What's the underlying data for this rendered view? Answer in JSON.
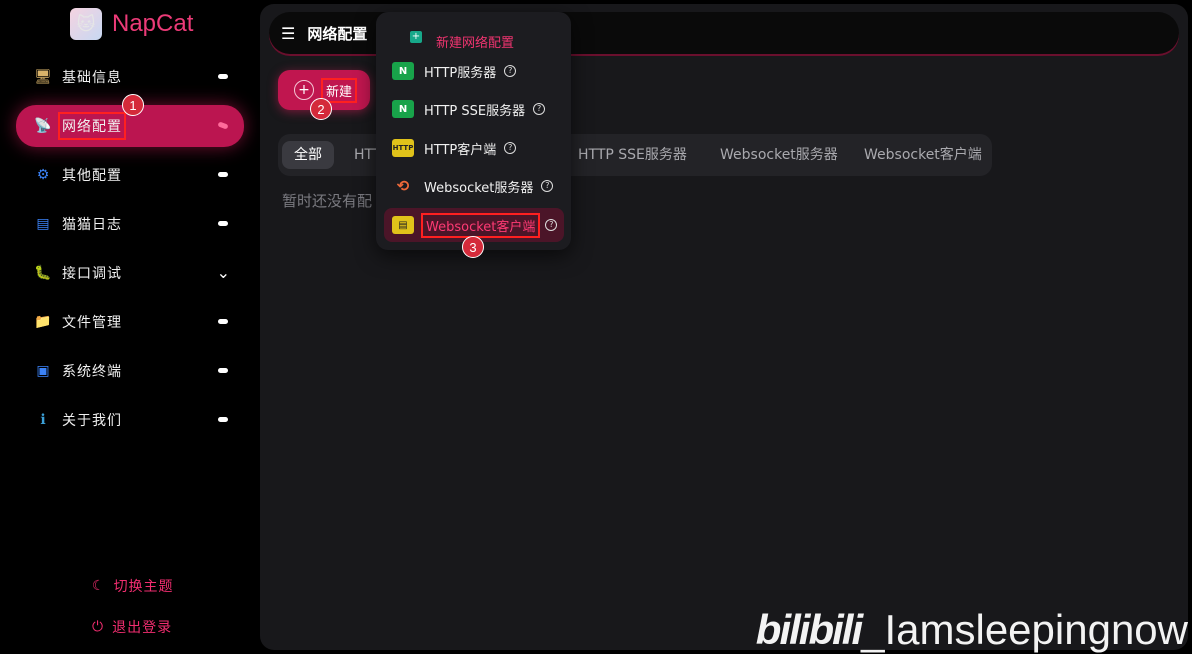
{
  "brand": {
    "name": "NapCat",
    "logo_icon": "cat-avatar-icon"
  },
  "sidebar": {
    "items": [
      {
        "label": "基础信息",
        "icon": "dashboard-icon"
      },
      {
        "label": "网络配置",
        "icon": "network-icon",
        "active": true
      },
      {
        "label": "其他配置",
        "icon": "gear-icon"
      },
      {
        "label": "猫猫日志",
        "icon": "log-icon"
      },
      {
        "label": "接口调试",
        "icon": "debug-icon"
      },
      {
        "label": "文件管理",
        "icon": "folder-icon"
      },
      {
        "label": "系统终端",
        "icon": "terminal-icon"
      },
      {
        "label": "关于我们",
        "icon": "info-icon"
      }
    ],
    "theme_toggle": "切换主题",
    "logout": "退出登录"
  },
  "header": {
    "title": "网络配置"
  },
  "toolbar": {
    "new_label": "新建"
  },
  "tabs": [
    "全部",
    "HTTP服务器",
    "HTTP SSE服务器",
    "HTTP客户端",
    "HTTP SSE服务器",
    "Websocket服务器",
    "Websocket客户端"
  ],
  "tab_visible": {
    "all": "全部",
    "http_partial": "HTT",
    "http_sse": "HTTP SSE服务器",
    "ws_server": "Websocket服务器",
    "ws_client": "Websocket客户端"
  },
  "empty_text": "暂时还没有配",
  "dropdown": {
    "header": "新建网络配置",
    "items": [
      {
        "label": "HTTP服务器"
      },
      {
        "label": "HTTP SSE服务器"
      },
      {
        "label": "HTTP客户端"
      },
      {
        "label": "Websocket服务器"
      },
      {
        "label": "Websocket客户端"
      }
    ]
  },
  "step_badges": [
    "1",
    "2",
    "3"
  ],
  "watermark": {
    "logo": "bilibili",
    "handle": "_Iamsleepingnow"
  },
  "colors": {
    "accent": "#c0164f",
    "accent_text": "#f03470",
    "panel": "#18181b"
  }
}
